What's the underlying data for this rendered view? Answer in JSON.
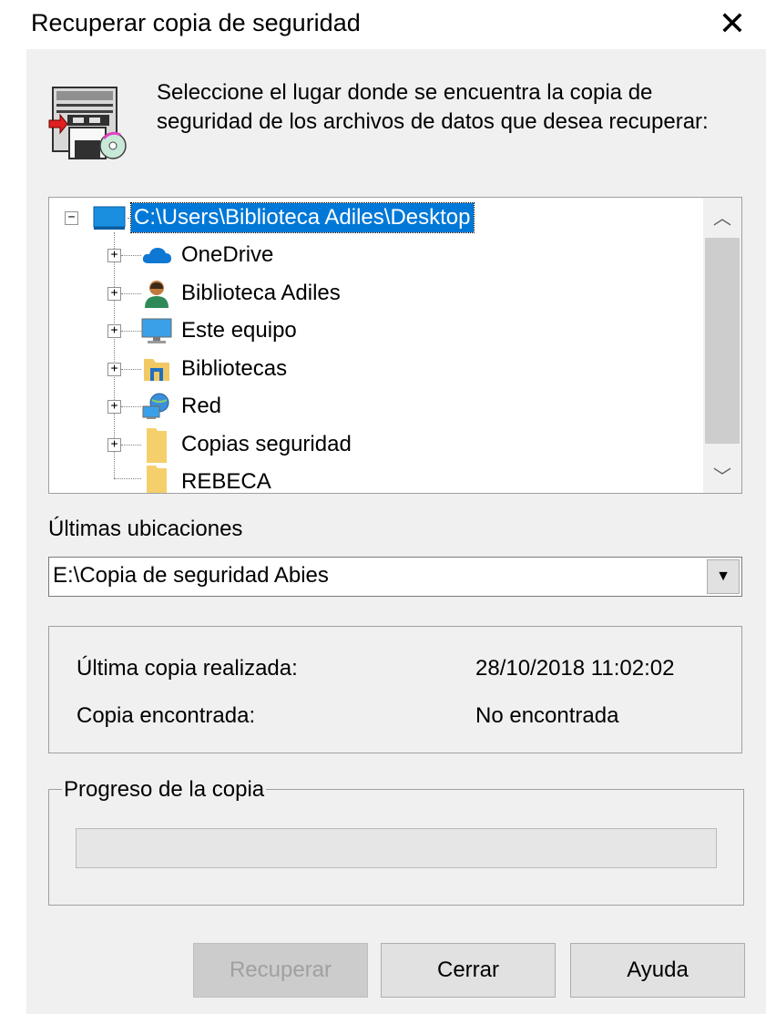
{
  "window": {
    "title": "Recuperar copia de seguridad",
    "close_glyph": "✕",
    "dialog_icon": "backup-restore-icon"
  },
  "intro_text": "Seleccione el lugar donde se encuentra la copia de seguridad de los archivos de datos que desea recuperar:",
  "tree": {
    "root": {
      "label": "C:\\Users\\Biblioteca Adiles\\Desktop",
      "icon": "desktop-icon",
      "expander": "−",
      "selected": true
    },
    "children": [
      {
        "label": "OneDrive",
        "icon": "onedrive-cloud-icon",
        "expander": "+"
      },
      {
        "label": "Biblioteca Adiles",
        "icon": "user-icon",
        "expander": "+"
      },
      {
        "label": "Este equipo",
        "icon": "computer-icon",
        "expander": "+"
      },
      {
        "label": "Bibliotecas",
        "icon": "libraries-folder-icon",
        "expander": "+"
      },
      {
        "label": "Red",
        "icon": "network-icon",
        "expander": "+"
      },
      {
        "label": "Copias seguridad",
        "icon": "folder-icon",
        "expander": "+"
      },
      {
        "label": "REBECA",
        "icon": "folder-icon",
        "expander": ""
      }
    ],
    "scroll_up_glyph": "︿",
    "scroll_down_glyph": "﹀"
  },
  "recent": {
    "label": "Últimas ubicaciones",
    "value": "E:\\Copia de seguridad Abies",
    "arrow_glyph": "▼"
  },
  "info": {
    "last_copy_label": "Última copia realizada:",
    "last_copy_value": "28/10/2018 11:02:02",
    "found_label": "Copia encontrada:",
    "found_value": "No encontrada"
  },
  "progress": {
    "title": "Progreso de la copia",
    "fraction": 0
  },
  "buttons": {
    "recover": "Recuperar",
    "close": "Cerrar",
    "help": "Ayuda"
  },
  "colors": {
    "selection": "#0078d7",
    "dialog_bg": "#f0f0f0"
  }
}
